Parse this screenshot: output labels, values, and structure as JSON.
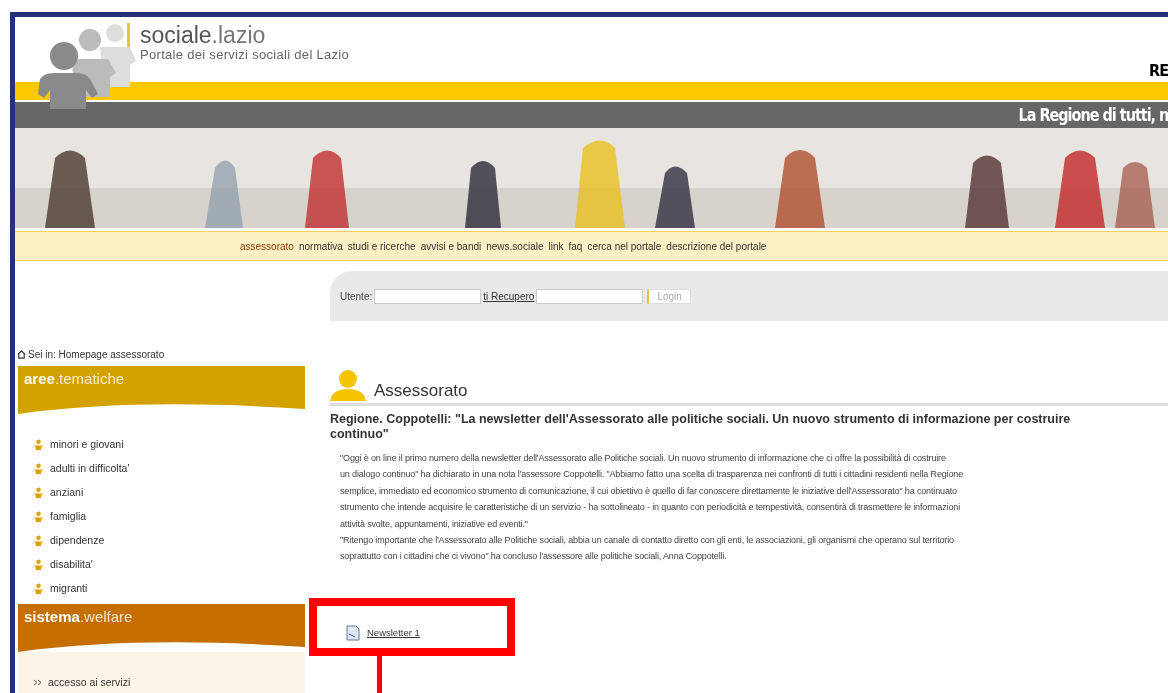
{
  "header": {
    "logo_bold": "sociale",
    "logo_light": ".lazio",
    "subtitle": "Portale dei servizi sociali del Lazio",
    "region_label": "RE",
    "slogan": "La Regione di tutti, n"
  },
  "nav": [
    {
      "label": "assessorato",
      "selected": true
    },
    {
      "label": "normativa",
      "selected": false
    },
    {
      "label": "studi e ricerche",
      "selected": false
    },
    {
      "label": "avvisi e bandi",
      "selected": false
    },
    {
      "label": "news.sociale",
      "selected": false
    },
    {
      "label": "link",
      "selected": false
    },
    {
      "label": "faq",
      "selected": false
    },
    {
      "label": "cerca nel portale",
      "selected": false
    },
    {
      "label": "descrizione del portale",
      "selected": false
    }
  ],
  "login": {
    "user_label": "Utente:",
    "recover_link": "ti Recupero",
    "button": "Login",
    "button_disabled": true
  },
  "breadcrumb": "Sei in: Homepage assessorato",
  "sidebar": [
    {
      "title_bold": "aree",
      "title_light": ".tematiche",
      "color": "#d4a200",
      "kind": "people",
      "items": [
        "minori e giovani",
        "adulti in difficolta'",
        "anziani",
        "famiglia",
        "dipendenze",
        "disabilita'",
        "migranti"
      ]
    },
    {
      "title_bold": "sistema",
      "title_light": ".welfare",
      "color": "#c46f00",
      "kind": "arrows",
      "items": [
        "accesso ai servizi"
      ]
    }
  ],
  "content": {
    "title": "Assessorato",
    "headline": "Regione. Coppotelli: \"La newsletter dell'Assessorato alle politiche sociali. Un nuovo strumento di informazione per costruire",
    "headline_2": "continuo\"",
    "paragraph_lines": [
      "\"Oggi è on line il primo numero della newsletter dell'Assessorato alle Politiche sociali. Un nuovo strumento di informazione che ci offre la possibilità di costruire",
      "un dialogo continuo\" ha dichiarato in una nota l'assessore Coppotelli. \"Abbiamo fatto una scelta di trasparenza nei confronti di tutti i cittadini residenti nella Regione",
      "semplice, immediato ed economico strumento di comunicazione, il cui obiettivo è quello di far conoscere direttamente le iniziative dell'Assessorato\" ha continuato",
      "strumento che intende acquisire le caratteristiche di un servizio - ha sottolineato - in quanto con periodicità e tempestività, consentirà di trasmettere le informazioni",
      "attività svolte, appuntamenti, iniziative ed eventi.\"",
      "\"Ritengo importante che l'Assessorato alle Politiche sociali, abbia un canale di contatto diretto con gli enti, le associazioni, gli organismi che operano sul territorio",
      "soprattutto con i cittadini che ci vivono\" ha concluso l'assessore alle politiche sociali, Anna Coppotelli."
    ],
    "attachment": "Newsletter 1"
  }
}
